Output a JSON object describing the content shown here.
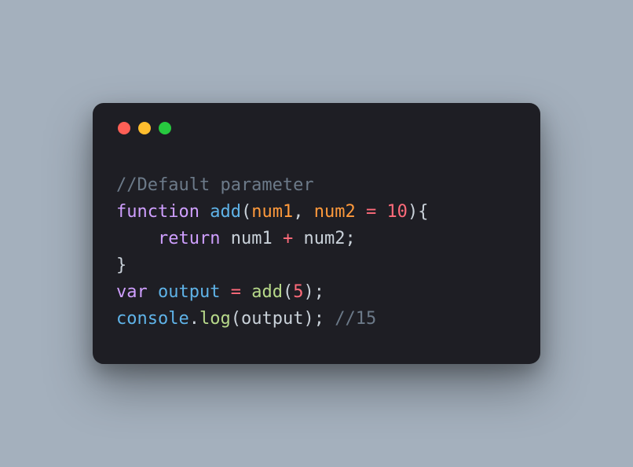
{
  "titlebar": {
    "buttons": [
      "close",
      "minimize",
      "zoom"
    ]
  },
  "code": {
    "line1": {
      "comment": "//Default parameter"
    },
    "line2": {
      "kw_function": "function",
      "sp1": " ",
      "fn_name": "add",
      "open_paren": "(",
      "param1": "num1",
      "comma": ", ",
      "param2": "num2",
      "sp2": " ",
      "eq": "=",
      "sp3": " ",
      "default_val": "10",
      "close_paren": ")",
      "open_brace": "{"
    },
    "line3": {
      "indent": "    ",
      "kw_return": "return",
      "sp1": " ",
      "id1": "num1",
      "sp2": " ",
      "plus": "+",
      "sp3": " ",
      "id2": "num2",
      "semi": ";"
    },
    "line4": {
      "close_brace": "}"
    },
    "line5": {
      "kw_var": "var",
      "sp1": " ",
      "varname": "output",
      "sp2": " ",
      "eq": "=",
      "sp3": " ",
      "call": "add",
      "open_paren": "(",
      "arg": "5",
      "close_paren": ")",
      "semi": ";"
    },
    "line6": {
      "obj": "console",
      "dot": ".",
      "method": "log",
      "open_paren": "(",
      "arg": "output",
      "close_paren": ")",
      "semi": ";",
      "sp": " ",
      "comment": "//15"
    }
  }
}
